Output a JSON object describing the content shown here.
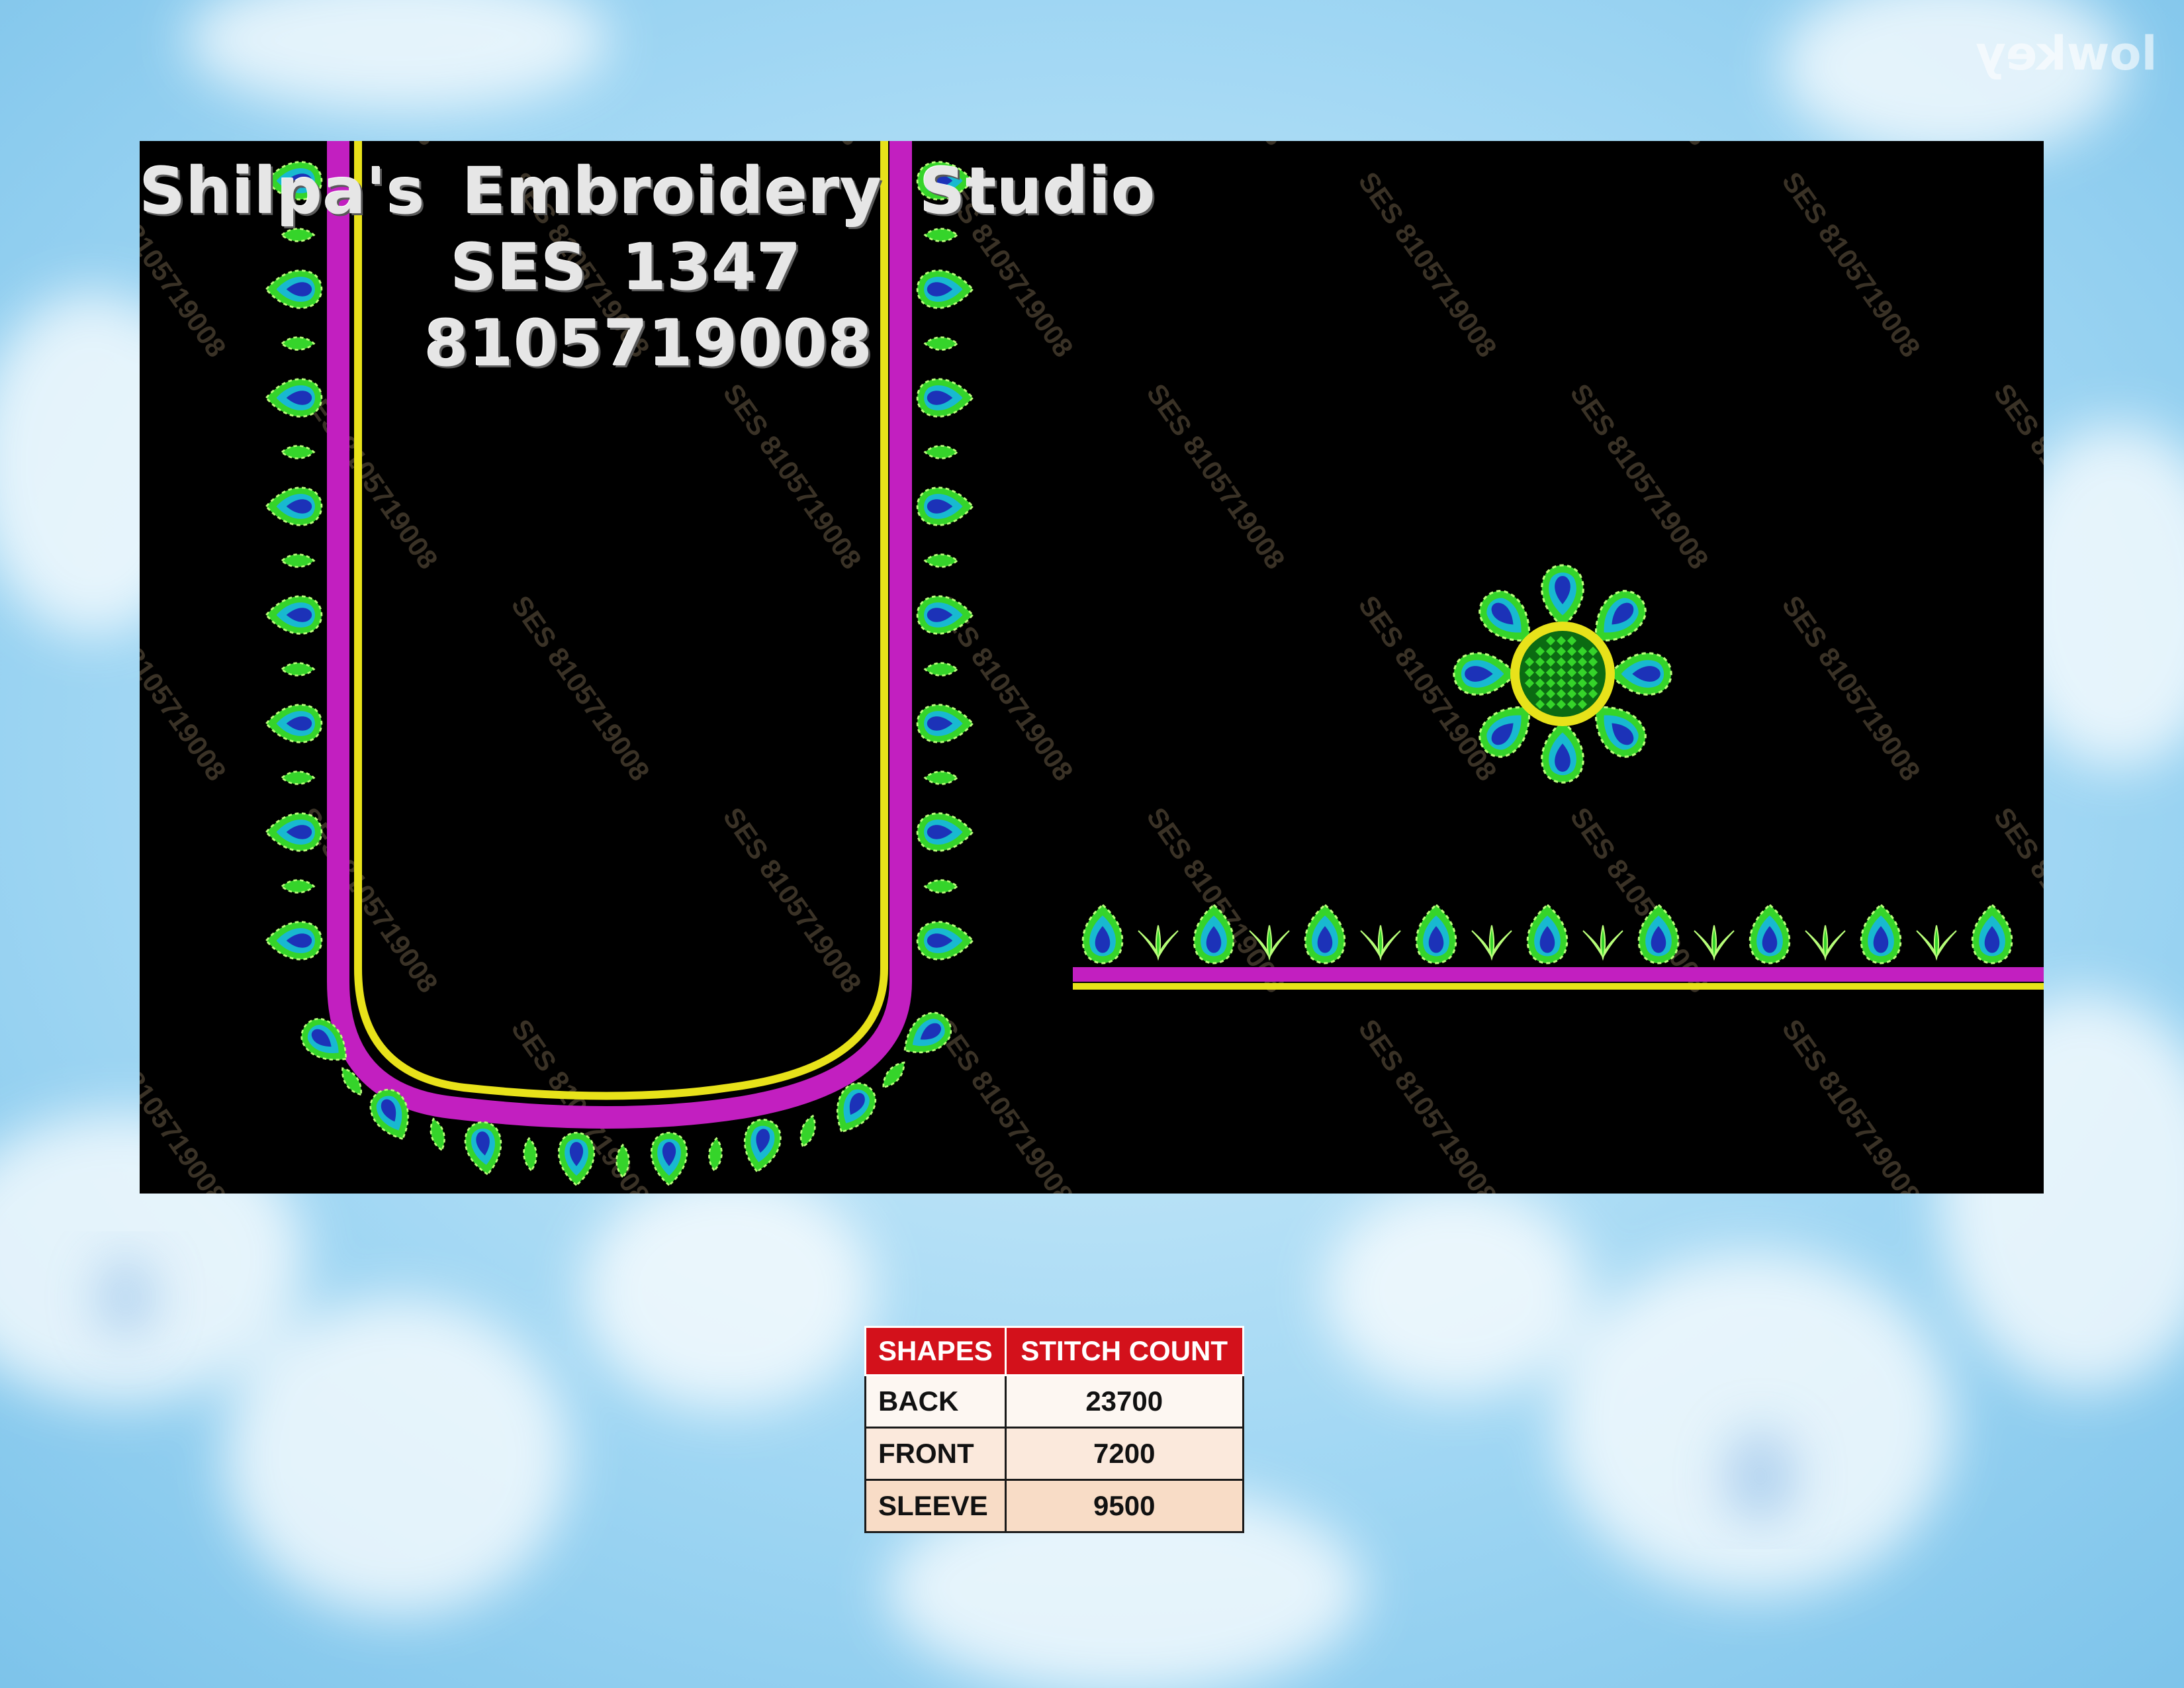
{
  "studio": {
    "name": "Shilpa's Embroidery Studio",
    "code": "SES 1347",
    "phone": "8105719008"
  },
  "watermark": {
    "text": "SES 8105719008"
  },
  "corner_logo": {
    "text": "lowkey"
  },
  "table": {
    "headers": [
      "SHAPES",
      "STITCH COUNT"
    ],
    "rows": [
      {
        "shape": "BACK",
        "count": "23700"
      },
      {
        "shape": "FRONT",
        "count": "7200"
      },
      {
        "shape": "SLEEVE",
        "count": "9500"
      }
    ]
  },
  "colors": {
    "panel": "#000000",
    "magenta": "#c21fc0",
    "yellow": "#e8e21a",
    "leaf_green": "#35d42a",
    "peacock_teal": "#18b9d0",
    "peacock_blue": "#1c32b8",
    "header_red": "#d3111b"
  }
}
